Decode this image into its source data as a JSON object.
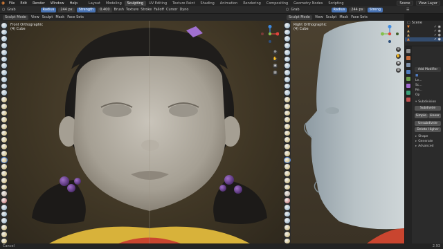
{
  "menubar": {
    "menus": [
      "File",
      "Edit",
      "Render",
      "Window",
      "Help"
    ],
    "workspaces": [
      "Layout",
      "Modeling",
      "Sculpting",
      "UV Editing",
      "Texture Paint",
      "Shading",
      "Animation",
      "Rendering",
      "Compositing",
      "Geometry Nodes",
      "Scripting"
    ],
    "active_workspace": "Sculpting",
    "scene": "Scene",
    "view_layer": "View Layer"
  },
  "toolheader_left": {
    "tool": "Grab",
    "radius_label": "Radius",
    "radius_value": "244 px",
    "strength_label": "Strength",
    "strength_value": "0.400",
    "brush": "Brush",
    "texture": "Texture",
    "stroke": "Stroke",
    "falloff": "Falloff",
    "cursor": "Cursor",
    "dyntopo": "Dyno"
  },
  "toolheader_right": {
    "tool": "Grab",
    "radius_label": "Radius",
    "radius_value": "244 px",
    "strength_label": "Streng"
  },
  "viewport_left": {
    "mode": "Sculpt Mode",
    "menus": [
      "View",
      "Sculpt",
      "Mask",
      "Face Sets"
    ],
    "view_name": "Front Orthographic",
    "object": "(4) Cube"
  },
  "viewport_right": {
    "mode": "Sculpt Mode",
    "menus": [
      "View",
      "Sculpt",
      "Mask",
      "Face Sets"
    ],
    "view_name": "Right Orthographic",
    "object": "(4) Cube"
  },
  "properties": {
    "add_modifier": "Add Modifier",
    "subdivision": "Subdivision",
    "subdivide": "Subdivide",
    "simple": "Simple",
    "linear": "Linear",
    "unsubdivide": "Unsubdivide",
    "delete_higher": "Delete Higher",
    "shape": "Shape",
    "generate": "Generate",
    "advanced": "Advanced",
    "rows": [
      "Le...",
      "Sc...",
      "Re...",
      "Op"
    ]
  },
  "outliner": {
    "title": "Scene",
    "rows": [
      "",
      "",
      "",
      ""
    ]
  },
  "statusbar": {
    "left": "Cancel",
    "version": "2.93"
  },
  "colors": {
    "accent": "#4772b3",
    "orange": "#e8873a",
    "viewport_bg": "#4a3f2c"
  }
}
